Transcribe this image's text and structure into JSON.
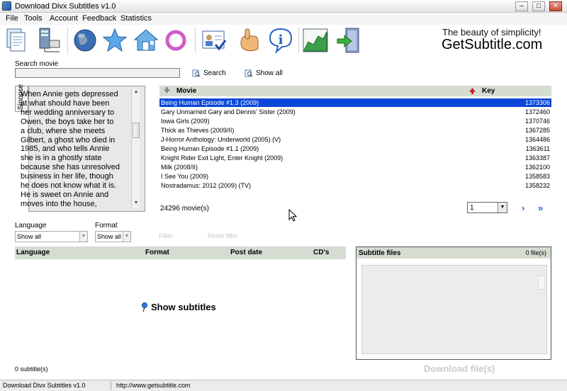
{
  "window": {
    "title": "Download Divx Subtitles v1.0"
  },
  "menu": [
    "File",
    "Tools",
    "Account",
    "Feedback",
    "Statistics"
  ],
  "toolbar": {
    "icons": [
      "documents-icon",
      "network-icon",
      "globe-icon",
      "star-icon",
      "home-icon",
      "ring-icon",
      "profile-card-icon",
      "hand-icon",
      "info-icon",
      "chart-icon",
      "exit-door-icon"
    ],
    "slogan": "The beauty of simplicity!",
    "brand": "GetSubtitle.com"
  },
  "search": {
    "label": "Search movie",
    "value": "",
    "search_button": "Search",
    "show_all_button": "Show all"
  },
  "synopsis": {
    "tab_label": "Sinopse",
    "lines": [
      "When Annie gets depressed",
      "at what should have been",
      "her wedding anniversary to",
      "Owen, the boys take her to",
      "a club, where she meets",
      "Gilbert, a ghost who died in",
      "1985, and who tells Annie",
      "she is in a ghostly state",
      "because she has unresolved",
      "business in her life, though",
      "he does not know what it is.",
      "He is sweet on Annie and",
      "moves into the house,"
    ]
  },
  "movies": {
    "col_movie": "Movie",
    "col_key": "Key",
    "rows": [
      {
        "title": "Being Human Episode #1.3 (2009)",
        "key": "1373306",
        "selected": true
      },
      {
        "title": "Gary Unmarried Gary and Dennis' Sister (2009)",
        "key": "1372460"
      },
      {
        "title": "Iowa Girls (2009)",
        "key": "1370746"
      },
      {
        "title": "Thick as Thieves (2009/II)",
        "key": "1367285"
      },
      {
        "title": "J-Horror Anthology: Underworld (2005) (V)",
        "key": "1364486"
      },
      {
        "title": "Being Human Episode #1.1 (2009)",
        "key": "1363611"
      },
      {
        "title": "Knight Rider Exit Light, Enter Knight (2009)",
        "key": "1363387"
      },
      {
        "title": "Milk (2008/II)",
        "key": "1362100"
      },
      {
        "title": "I See You (2009)",
        "key": "1358583"
      },
      {
        "title": "Nostradamus: 2012 (2009) (TV)",
        "key": "1358232"
      }
    ],
    "count_text": "24296 movie(s)",
    "page_value": "1",
    "next_glyph": "›",
    "last_glyph": "»"
  },
  "filters": {
    "language_label": "Language",
    "language_value": "Show all",
    "format_label": "Format",
    "format_value": "Show all",
    "filter_button": "Filter",
    "reset_button": "Reset filter"
  },
  "subtitles": {
    "col_language": "Language",
    "col_format": "Format",
    "col_post_date": "Post date",
    "col_cds": "CD's",
    "show_label": "Show subtitles",
    "count_text": "0 subtitle(s)"
  },
  "subtitle_files": {
    "title": "Subtitle files",
    "count_text": "0 file(s)",
    "download_button": "Download file(s)"
  },
  "status": {
    "left": "Download Divx Subtitles v1.0",
    "url": "http://www.getsubtitle.com"
  },
  "colors": {
    "selection": "#0a47d8",
    "grid_header": "#d5ddd2",
    "nav_arrow": "#1a6bd8"
  }
}
